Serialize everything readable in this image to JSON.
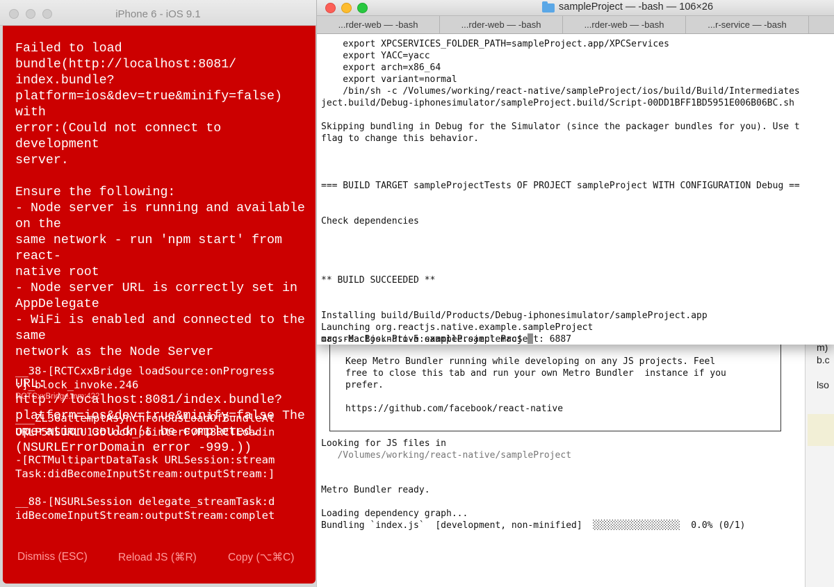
{
  "simulator": {
    "title": "iPhone 6 - iOS 9.1",
    "error_message": "Failed to load bundle(http://localhost:8081/\nindex.bundle?\nplatform=ios&dev=true&minify=false) with\nerror:(Could not connect to development\nserver.\n\nEnsure the following:\n- Node server is running and available on the\nsame network - run 'npm start' from react-\nnative root\n- Node server URL is correctly set in\nAppDelegate\n- WiFi is enabled and connected to the same\nnetwork as the Node Server\n\nURL: http://localhost:8081/index.bundle?\nplatform=ios&dev=true&minify=false The\noperation couldn’t be completed.\n(NSURLErrorDomain error -999.))",
    "stack": [
      {
        "fn": "__38-[RCTCxxBridge loadSource:onProgress\n:]_block_invoke.246",
        "file": "RCTCxxBridge.mm:422"
      },
      {
        "fn": "___ZL36attemptAsynchronousLoadOfBundleAt\nURLP5NSURLU13block_pointerFvP18RCTLoadin",
        "file": ""
      },
      {
        "fn": "-[RCTMultipartDataTask URLSession:stream\nTask:didBecomeInputStream:outputStream:]",
        "file": ""
      },
      {
        "fn": "__88-[NSURLSession delegate_streamTask:d\nidBecomeInputStream:outputStream:complet",
        "file": ""
      }
    ],
    "buttons": {
      "dismiss": "Dismiss (ESC)",
      "reload": "Reload JS (⌘R)",
      "copy": "Copy (⌥⌘C)"
    }
  },
  "terminal": {
    "title": "sampleProject — -bash — 106×26",
    "tabs": [
      "...rder-web — -bash",
      "...rder-web — -bash",
      "...rder-web — -bash",
      "...r-service — -bash"
    ],
    "output": "    export XPCSERVICES_FOLDER_PATH=sampleProject.app/XPCServices\n    export YACC=yacc\n    export arch=x86_64\n    export variant=normal\n    /bin/sh -c /Volumes/working/react-native/sampleProject/ios/build/Build/Intermediates\nject.build/Debug-iphonesimulator/sampleProject.build/Script-00DD1BFF1BD5951E006B06BC.sh\n\nSkipping bundling in Debug for the Simulator (since the packager bundles for you). Use t\nflag to change this behavior.\n\n\n\n=== BUILD TARGET sampleProjectTests OF PROJECT sampleProject WITH CONFIGURATION Debug ==\n\n\nCheck dependencies\n\n\n\n\n** BUILD SUCCEEDED **\n\n\nInstalling build/Build/Products/Debug-iphonesimulator/sampleProject.app\nLaunching org.reactjs.native.example.sampleProject\norg.reactjs.native.example.sampleProject: 6887",
    "prompt": "macs-MacBook-Pro-5:sampleProject mac$ "
  },
  "metro_terminal": {
    "box_text": "Keep Metro Bundler running while developing on any JS projects. Feel\nfree to close this tab and run your own Metro Bundler  instance if you\nprefer.\n\nhttps://github.com/facebook/react-native",
    "looking": "Looking for JS files in",
    "path": "   /Volumes/working/react-native/sampleProject",
    "ready": "Metro Bundler ready.",
    "loading": "Loading dependency graph...",
    "bundling": "Bundling `index.js`  [development, non-minified]  ░░░░░░░░░░░░░░░░  0.0% (0/1)",
    "side_fragments": [
      "m)",
      "b.c",
      "lso"
    ]
  }
}
